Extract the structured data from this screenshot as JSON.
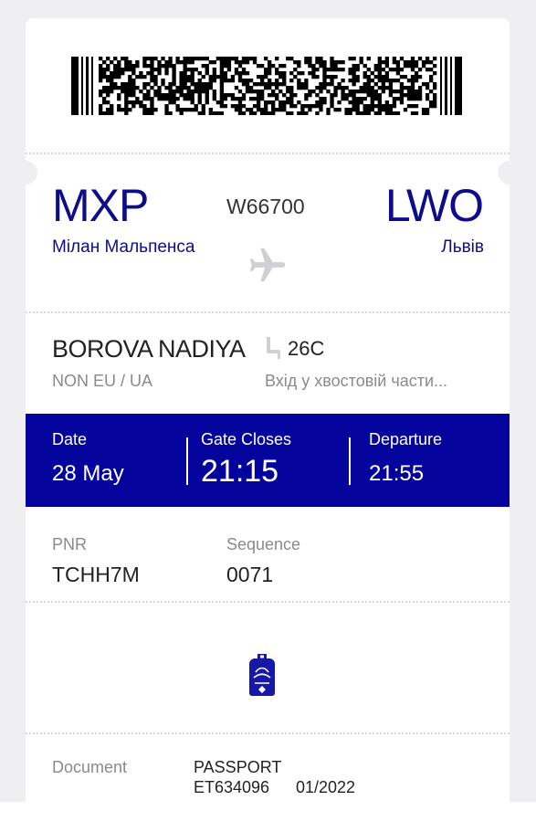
{
  "flight": {
    "origin_code": "MXP",
    "origin_city": "Мілан Мальпенса",
    "number": "W66700",
    "destination_code": "LWO",
    "destination_city": "Львів"
  },
  "passenger": {
    "name": "BOROVA NADIYA",
    "category": "NON EU / UA",
    "seat": "26C",
    "boarding_note": "Вхід у хвостовій части..."
  },
  "times": {
    "date_label": "Date",
    "date_value": "28 May",
    "gate_label": "Gate Closes",
    "gate_value": "21:15",
    "departure_label": "Departure",
    "departure_value": "21:55"
  },
  "booking": {
    "pnr_label": "PNR",
    "pnr_value": "TCHH7M",
    "sequence_label": "Sequence",
    "sequence_value": "0071"
  },
  "document": {
    "label": "Document",
    "type": "PASSPORT",
    "number": "ET634096",
    "expiry": "01/2022"
  },
  "icons": {
    "plane": "plane-icon",
    "seat": "seat-icon",
    "bag": "backpack-icon",
    "barcode": "barcode"
  },
  "colors": {
    "brand": "#04049c",
    "text_brand": "#0d0d8c"
  }
}
